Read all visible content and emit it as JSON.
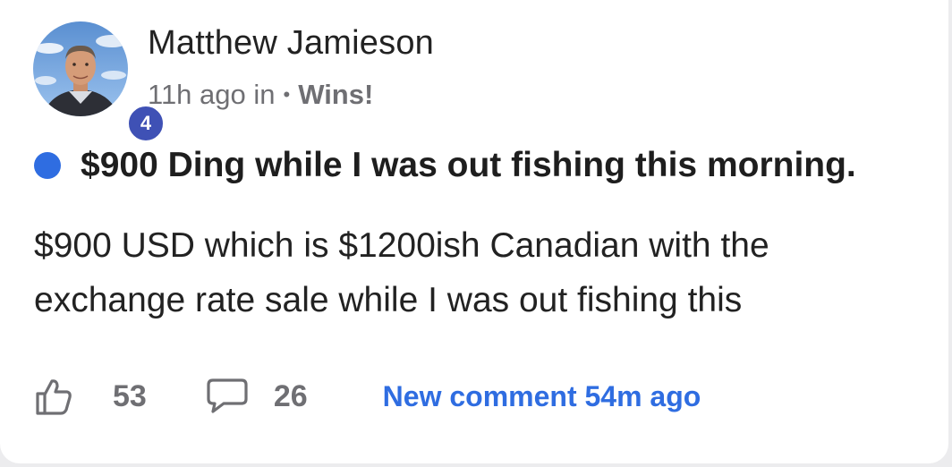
{
  "post": {
    "author_name": "Matthew Jamieson",
    "author_level": "4",
    "time_ago": "11h ago in",
    "separator": "•",
    "category": "Wins!",
    "title": "$900 Ding while I was out fishing this morning.",
    "body": "$900 USD which is $1200ish Canadian with the exchange rate sale while I was out fishing this",
    "unread": true
  },
  "actions": {
    "like_count": "53",
    "comment_count": "26",
    "new_comment_text": "New comment 54m ago"
  },
  "colors": {
    "accent": "#2f6de1",
    "level_badge": "#3f51b5",
    "muted_text": "#6f6f73"
  }
}
